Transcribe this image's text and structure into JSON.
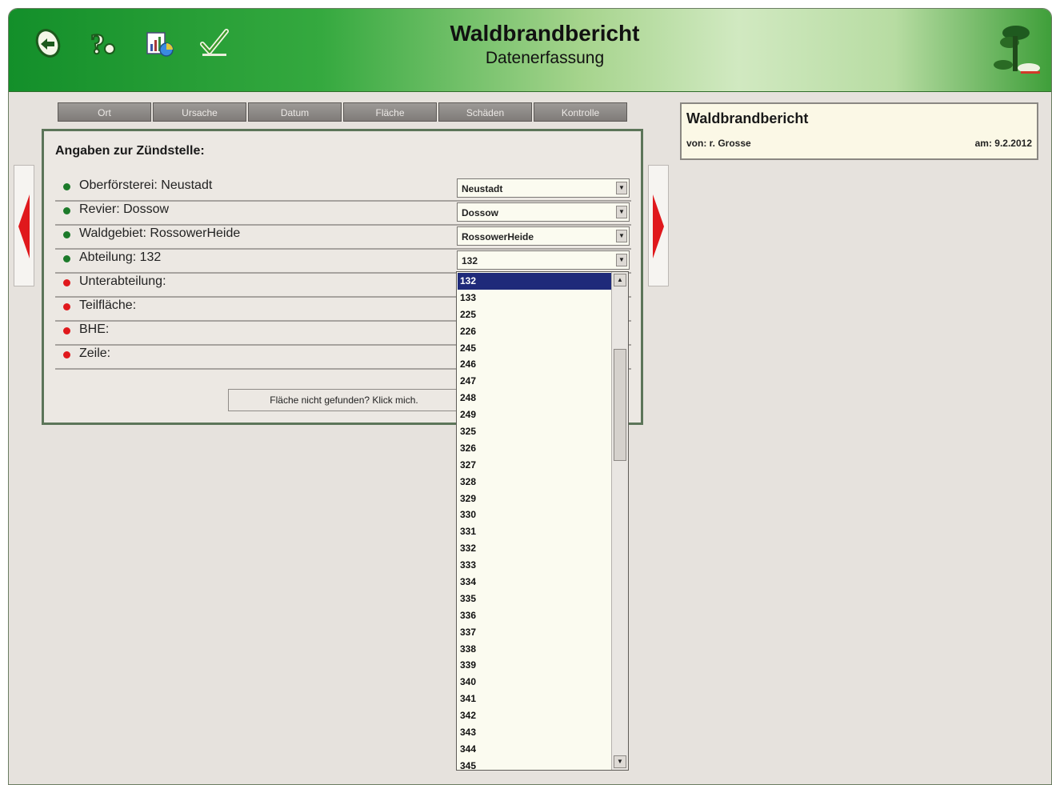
{
  "header": {
    "title": "Waldbrandbericht",
    "subtitle": "Datenerfassung",
    "toolbar": [
      {
        "name": "back-icon"
      },
      {
        "name": "help-icon"
      },
      {
        "name": "report-chart-icon"
      },
      {
        "name": "confirm-check-icon"
      }
    ]
  },
  "tabs": [
    "Ort",
    "Ursache",
    "Datum",
    "Fläche",
    "Schäden",
    "Kontrolle"
  ],
  "panel": {
    "title": "Angaben zur Zündstelle:",
    "rows": [
      {
        "label": "Oberförsterei: Neustadt",
        "status": "ok",
        "value": "Neustadt"
      },
      {
        "label": "Revier: Dossow",
        "status": "ok",
        "value": "Dossow"
      },
      {
        "label": "Waldgebiet: RossowerHeide",
        "status": "ok",
        "value": "RossowerHeide"
      },
      {
        "label": "Abteilung: 132",
        "status": "ok",
        "value": "132"
      },
      {
        "label": "Unterabteilung:",
        "status": "missing"
      },
      {
        "label": "Teilfläche:",
        "status": "missing"
      },
      {
        "label": "BHE:",
        "status": "missing"
      },
      {
        "label": "Zeile:",
        "status": "missing"
      }
    ],
    "not_found_button": "Fläche nicht gefunden? Klick mich."
  },
  "dropdown": {
    "selected": "132",
    "options": [
      "132",
      "133",
      "225",
      "226",
      "245",
      "246",
      "247",
      "248",
      "249",
      "325",
      "326",
      "327",
      "328",
      "329",
      "330",
      "331",
      "332",
      "333",
      "334",
      "335",
      "336",
      "337",
      "338",
      "339",
      "340",
      "341",
      "342",
      "343",
      "344",
      "345"
    ]
  },
  "report": {
    "title": "Waldbrandbericht",
    "from": "von: r. Grosse",
    "date": "am: 9.2.2012"
  },
  "colors": {
    "status_ok": "#1c7a2a",
    "status_missing": "#e0181c",
    "nav_arrow": "#e0181c",
    "header_green": "#138f2a"
  }
}
